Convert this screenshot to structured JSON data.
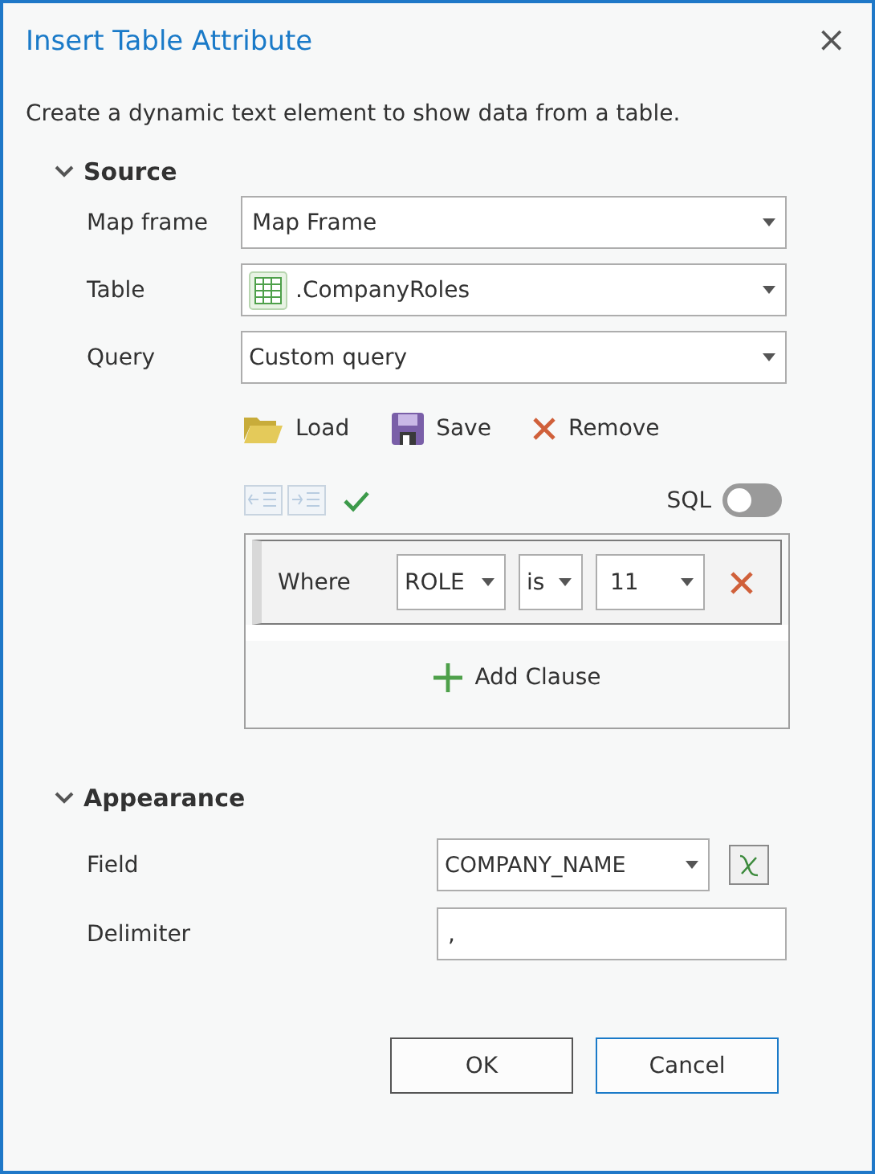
{
  "window": {
    "title": "Insert Table Attribute",
    "close": "×"
  },
  "description": "Create a dynamic text element to show data from a table.",
  "source": {
    "title": "Source",
    "expanded": true,
    "fields": [
      {
        "label": "Map frame",
        "value": "Map Frame",
        "kind": "plain"
      },
      {
        "label": "Table",
        "value": ".CompanyRoles",
        "kind": "table"
      },
      {
        "label": "Query",
        "value": "Custom query",
        "kind": "plain"
      }
    ],
    "actions": [
      {
        "label": "Load",
        "kind": "folder"
      },
      {
        "label": "Save",
        "kind": "save"
      },
      {
        "label": "Remove",
        "kind": "remove"
      }
    ],
    "tools": [
      {
        "kind": "outdent",
        "disabled": true
      },
      {
        "kind": "indent",
        "disabled": true
      },
      {
        "kind": "verify",
        "disabled": false
      }
    ],
    "sql": {
      "label": "SQL",
      "on": false
    },
    "clause": {
      "label": "Where",
      "field": "ROLE",
      "operator": "is",
      "value": "11"
    },
    "add_clause": "Add Clause"
  },
  "appearance": {
    "title": "Appearance",
    "expanded": true,
    "field_label": "Field",
    "field_value": "COMPANY_NAME",
    "delimiter_label": "Delimiter",
    "delimiter_value": ","
  },
  "buttons": [
    {
      "label": "OK",
      "focused": false
    },
    {
      "label": "Cancel",
      "focused": true
    }
  ]
}
